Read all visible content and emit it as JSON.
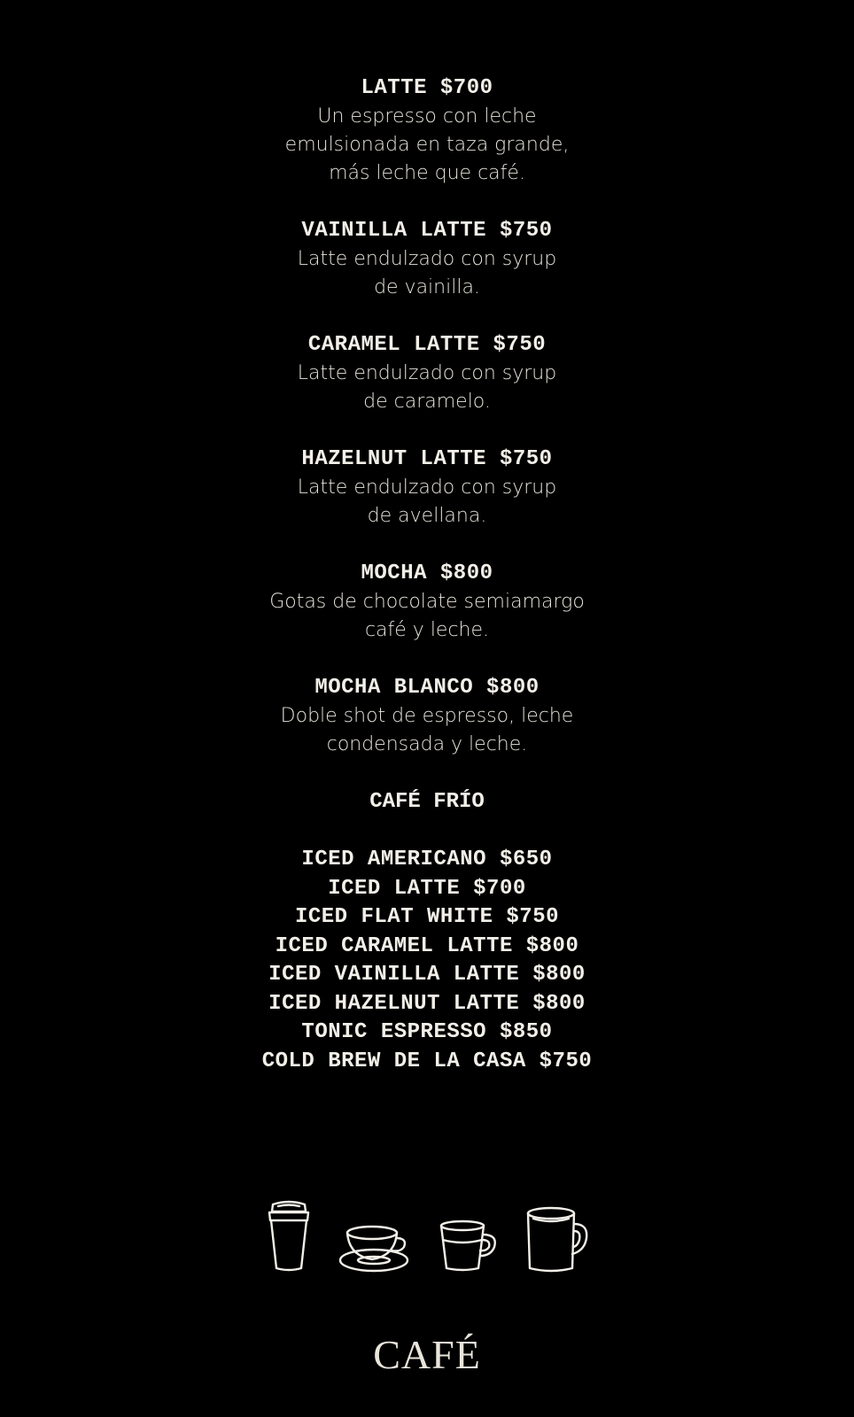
{
  "menu": {
    "items": [
      {
        "title": "LATTE $700",
        "description": "Un espresso con leche\nemulsionada en taza grande,\nmás leche que café."
      },
      {
        "title": "VAINILLA LATTE $750",
        "description": "Latte endulzado con syrup\nde vainilla."
      },
      {
        "title": "CARAMEL LATTE $750",
        "description": "Latte endulzado con syrup\nde caramelo."
      },
      {
        "title": "HAZELNUT LATTE $750",
        "description": "Latte endulzado con syrup\nde avellana."
      },
      {
        "title": "MOCHA $800",
        "description": "Gotas de chocolate semiamargo\ncafé y leche."
      },
      {
        "title": "MOCHA BLANCO $800",
        "description": "Doble shot de espresso, leche\ncondensada y leche."
      }
    ],
    "cold_section": {
      "title": "CAFÉ FRÍO",
      "items": [
        "ICED AMERICANO $650",
        "ICED LATTE $700",
        "ICED FLAT WHITE $750",
        "ICED CARAMEL LATTE $800",
        "ICED VAINILLA LATTE $800",
        "ICED HAZELNUT LATTE $800",
        "TONIC ESPRESSO $850",
        "COLD BREW DE LA CASA $750"
      ]
    }
  },
  "icons": [
    "takeaway-cup-icon",
    "cup-and-saucer-icon",
    "espresso-glass-icon",
    "mug-icon"
  ],
  "footer": {
    "title": "CAFÉ"
  },
  "colors": {
    "background": "#000000",
    "text": "#f2efe8"
  }
}
